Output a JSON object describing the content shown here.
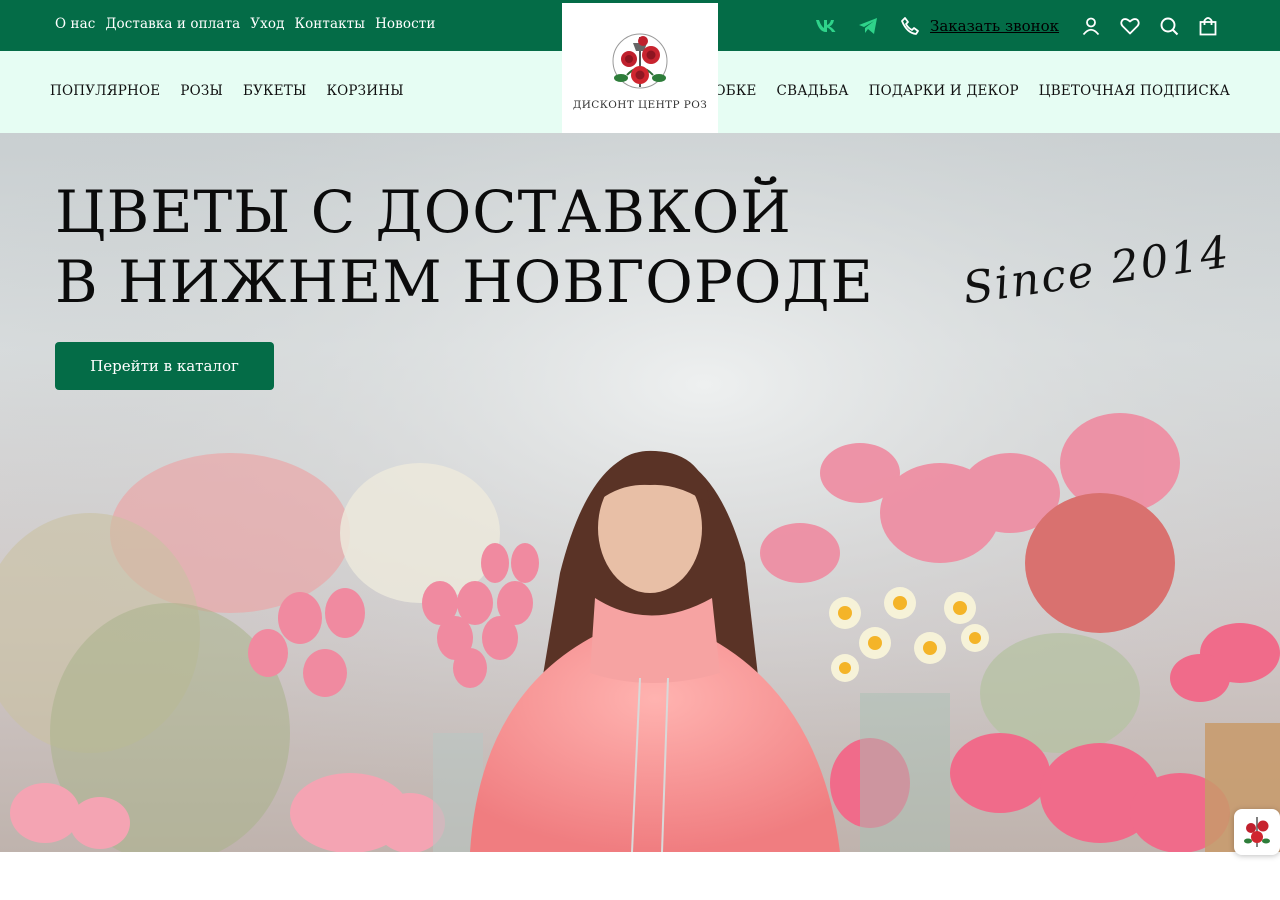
{
  "topbar": {
    "links": [
      "О нас",
      "Доставка и оплата",
      "Уход",
      "Контакты",
      "Новости"
    ],
    "call_label": "Заказать звонок",
    "icons": [
      "vk-icon",
      "telegram-icon",
      "phone-icon",
      "user-icon",
      "heart-icon",
      "search-icon",
      "bag-icon"
    ]
  },
  "nav": {
    "left": [
      "ПОПУЛЯРНОЕ",
      "РОЗЫ",
      "БУКЕТЫ",
      "КОРЗИНЫ"
    ],
    "right": [
      "В КОРОБКЕ",
      "СВАДЬБА",
      "ПОДАРКИ И ДЕКОР",
      "ЦВЕТОЧНАЯ ПОДПИСКА"
    ]
  },
  "logo": {
    "text": "ДИСКОНТ ЦЕНТР РОЗ"
  },
  "hero": {
    "title_line1": "ЦВЕТЫ С ДОСТАВКОЙ",
    "title_line2": "В НИЖНЕМ НОВГОРОДЕ",
    "since": "Since 2014",
    "cta_label": "Перейти в каталог"
  },
  "colors": {
    "brand_green": "#046c47",
    "nav_bg": "#e6fdf3",
    "accent_icon": "#2fd38a"
  }
}
